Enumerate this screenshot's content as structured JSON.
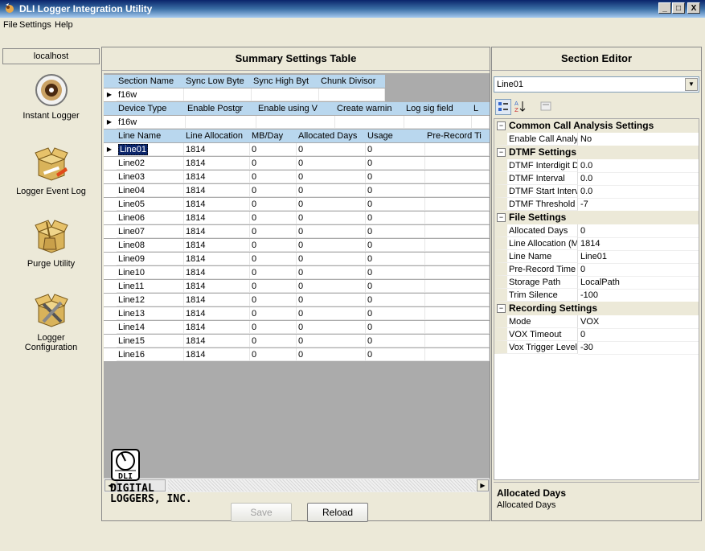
{
  "window": {
    "title": "DLI Logger Integration Utility",
    "controls": {
      "minimize": "_",
      "maximize": "□",
      "close": "X"
    }
  },
  "menu": [
    {
      "label": "File"
    },
    {
      "label": "Settings"
    },
    {
      "label": "Help"
    }
  ],
  "nav": {
    "host": "localhost",
    "items": [
      {
        "label": "Instant Logger",
        "icon": "disc-icon"
      },
      {
        "label": "Logger Event Log",
        "icon": "box-log-icon"
      },
      {
        "label": "Purge Utility",
        "icon": "box-broom-icon"
      },
      {
        "label": "Logger",
        "label2": "Configuration",
        "icon": "box-tools-icon"
      }
    ]
  },
  "summary": {
    "title": "Summary Settings Table",
    "section_headers": [
      "Section Name",
      "Sync Low Byte",
      "Sync High Byt",
      "Chunk Divisor"
    ],
    "section_row": [
      "f16w",
      "",
      "",
      ""
    ],
    "device_headers": [
      "Device Type",
      "Enable Postgr",
      "Enable using V",
      "Create warnin",
      "Log sig field",
      "L"
    ],
    "device_row": [
      "f16w",
      "",
      "",
      "",
      "",
      ""
    ],
    "line_headers": [
      "Line Name",
      "Line Allocation",
      "MB/Day",
      "Allocated Days",
      "Usage",
      "Pre-Record Ti"
    ],
    "lines": [
      [
        "Line01",
        "1814",
        "0",
        "0",
        "0",
        ""
      ],
      [
        "Line02",
        "1814",
        "0",
        "0",
        "0",
        ""
      ],
      [
        "Line03",
        "1814",
        "0",
        "0",
        "0",
        ""
      ],
      [
        "Line04",
        "1814",
        "0",
        "0",
        "0",
        ""
      ],
      [
        "Line05",
        "1814",
        "0",
        "0",
        "0",
        ""
      ],
      [
        "Line06",
        "1814",
        "0",
        "0",
        "0",
        ""
      ],
      [
        "Line07",
        "1814",
        "0",
        "0",
        "0",
        ""
      ],
      [
        "Line08",
        "1814",
        "0",
        "0",
        "0",
        ""
      ],
      [
        "Line09",
        "1814",
        "0",
        "0",
        "0",
        ""
      ],
      [
        "Line10",
        "1814",
        "0",
        "0",
        "0",
        ""
      ],
      [
        "Line11",
        "1814",
        "0",
        "0",
        "0",
        ""
      ],
      [
        "Line12",
        "1814",
        "0",
        "0",
        "0",
        ""
      ],
      [
        "Line13",
        "1814",
        "0",
        "0",
        "0",
        ""
      ],
      [
        "Line14",
        "1814",
        "0",
        "0",
        "0",
        ""
      ],
      [
        "Line15",
        "1814",
        "0",
        "0",
        "0",
        ""
      ],
      [
        "Line16",
        "1814",
        "0",
        "0",
        "0",
        ""
      ]
    ],
    "save_label": "Save",
    "reload_label": "Reload",
    "logo": {
      "mark": "DLI",
      "line1": "DIGITAL",
      "line2": "LOGGERS, INC."
    }
  },
  "editor": {
    "title": "Section Editor",
    "selected": "Line01",
    "categories": [
      {
        "name": "Common Call Analysis Settings",
        "props": [
          [
            "Enable Call Analys",
            "No"
          ]
        ]
      },
      {
        "name": "DTMF Settings",
        "props": [
          [
            "DTMF Interdigit De",
            "0.0"
          ],
          [
            "DTMF Interval",
            "0.0"
          ],
          [
            "DTMF Start Interva",
            "0.0"
          ],
          [
            "DTMF Threshold",
            "-7"
          ]
        ]
      },
      {
        "name": "File Settings",
        "props": [
          [
            "Allocated Days",
            "0"
          ],
          [
            "Line Allocation (M",
            "1814"
          ],
          [
            "Line Name",
            "Line01"
          ],
          [
            "Pre-Record Time (",
            "0"
          ],
          [
            "Storage Path",
            "LocalPath"
          ],
          [
            "Trim Silence",
            "-100"
          ]
        ]
      },
      {
        "name": "Recording Settings",
        "props": [
          [
            "Mode",
            "VOX"
          ],
          [
            "VOX Timeout",
            "0"
          ],
          [
            "Vox Trigger Level",
            "-30"
          ]
        ]
      }
    ],
    "description_title": "Allocated Days",
    "description_text": "Allocated Days"
  }
}
